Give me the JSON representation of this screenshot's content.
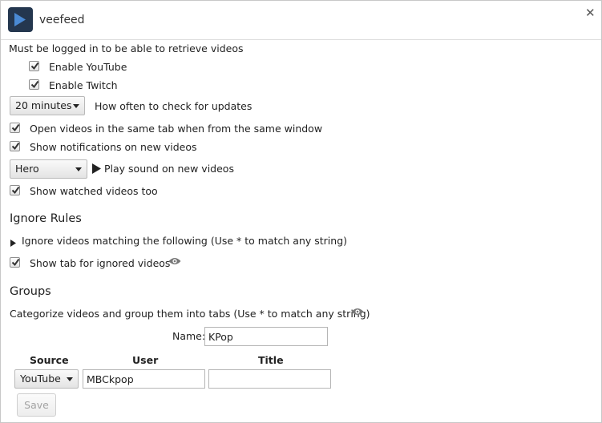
{
  "app": {
    "title": "veefeed"
  },
  "accounts": {
    "note": "Must be logged in to be able to retrieve videos",
    "youtube_label": "Enable YouTube",
    "twitch_label": "Enable Twitch"
  },
  "settings": {
    "interval_value": "20 minutes",
    "interval_label": "How often to check for updates",
    "same_tab_label": "Open videos in the same tab when from the same window",
    "notifications_label": "Show notifications on new videos",
    "sound_value": "Hero",
    "sound_label": "Play sound on new videos",
    "watched_label": "Show watched videos too"
  },
  "ignore": {
    "heading": "Ignore Rules",
    "toggle_label": "Ignore videos matching the following (Use * to match any string)",
    "show_tab_label": "Show tab for ignored videos"
  },
  "groups": {
    "heading": "Groups",
    "description": "Categorize videos and group them into tabs (Use * to match any string)",
    "name_label": "Name:",
    "name_value": "KPop",
    "columns": [
      "Source",
      "User",
      "Title"
    ],
    "row": {
      "source": "YouTube",
      "user": "MBCkpop",
      "title": ""
    },
    "save_label": "Save"
  }
}
